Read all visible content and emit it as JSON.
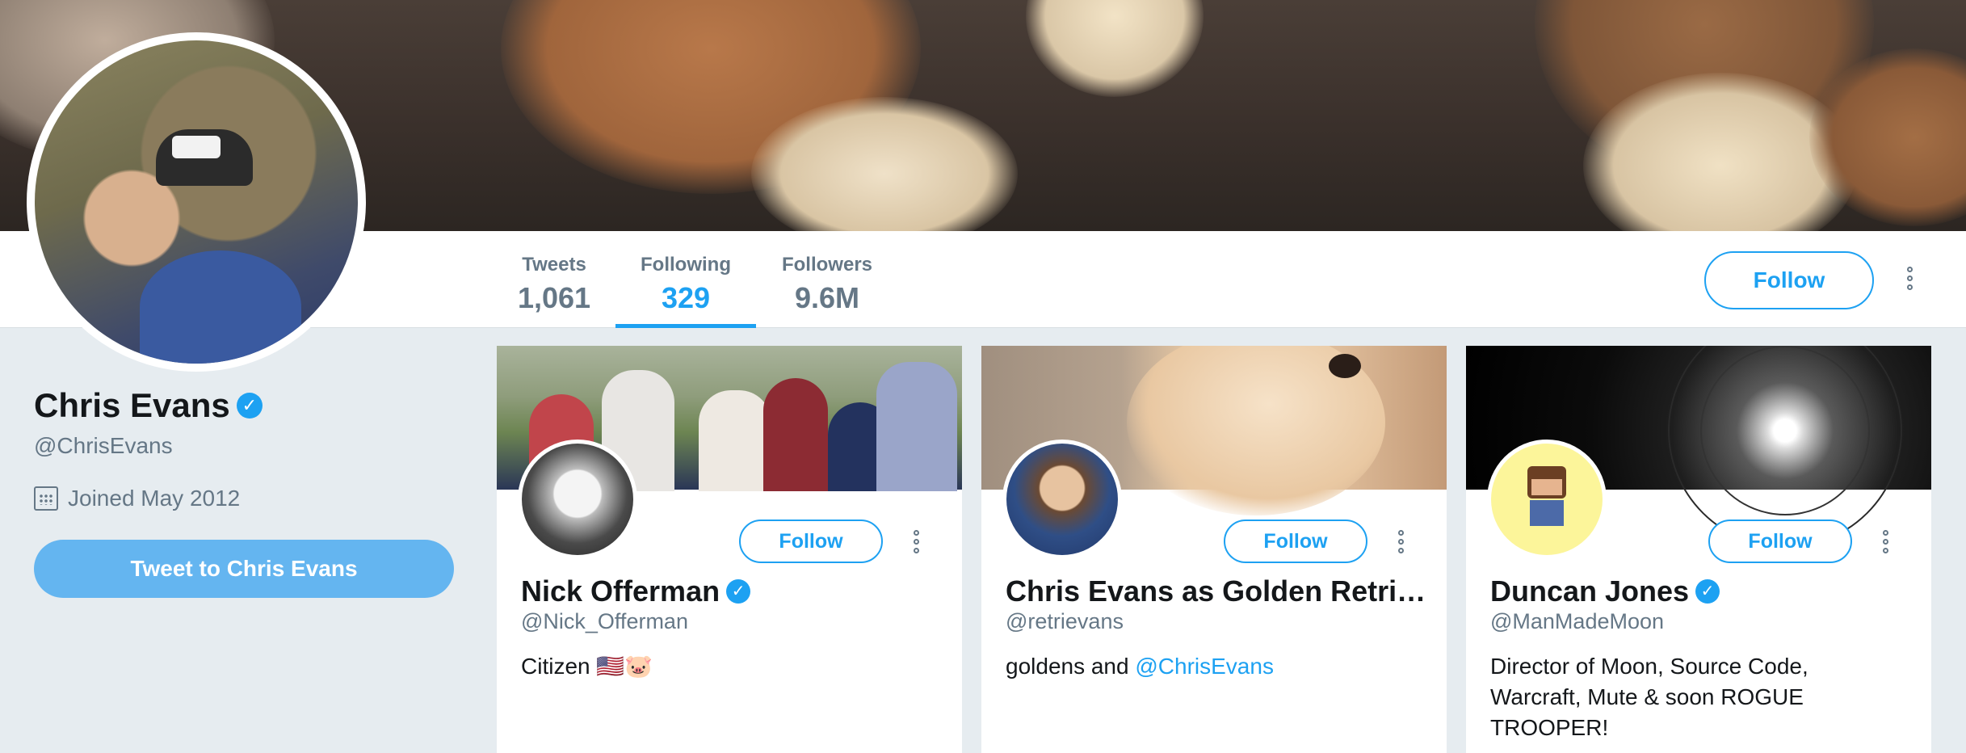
{
  "profile": {
    "name": "Chris Evans",
    "handle": "@ChrisEvans",
    "joined": "Joined May 2012",
    "tweet_to_label": "Tweet to Chris Evans",
    "follow_label": "Follow"
  },
  "stats": [
    {
      "label": "Tweets",
      "value": "1,061",
      "active": false
    },
    {
      "label": "Following",
      "value": "329",
      "active": true
    },
    {
      "label": "Followers",
      "value": "9.6M",
      "active": false
    }
  ],
  "cards": [
    {
      "name": "Nick Offerman",
      "verified": true,
      "handle": "@Nick_Offerman",
      "bio": "Citizen 🇺🇸🐷",
      "follow_label": "Follow"
    },
    {
      "name": "Chris Evans as Golden Retri…",
      "verified": false,
      "handle": "@retrievans",
      "bio_prefix": "goldens and ",
      "bio_mention": "@ChrisEvans",
      "follow_label": "Follow"
    },
    {
      "name": "Duncan Jones",
      "verified": true,
      "handle": "@ManMadeMoon",
      "bio": "Director of Moon, Source Code, Warcraft, Mute & soon ROGUE TROOPER!",
      "follow_label": "Follow"
    }
  ],
  "icons": {
    "verified": "verified-badge-icon",
    "calendar": "calendar-icon",
    "more": "more-options-icon"
  },
  "colors": {
    "accent": "#1da1f2",
    "muted": "#657786",
    "background": "#e6ecf0"
  }
}
